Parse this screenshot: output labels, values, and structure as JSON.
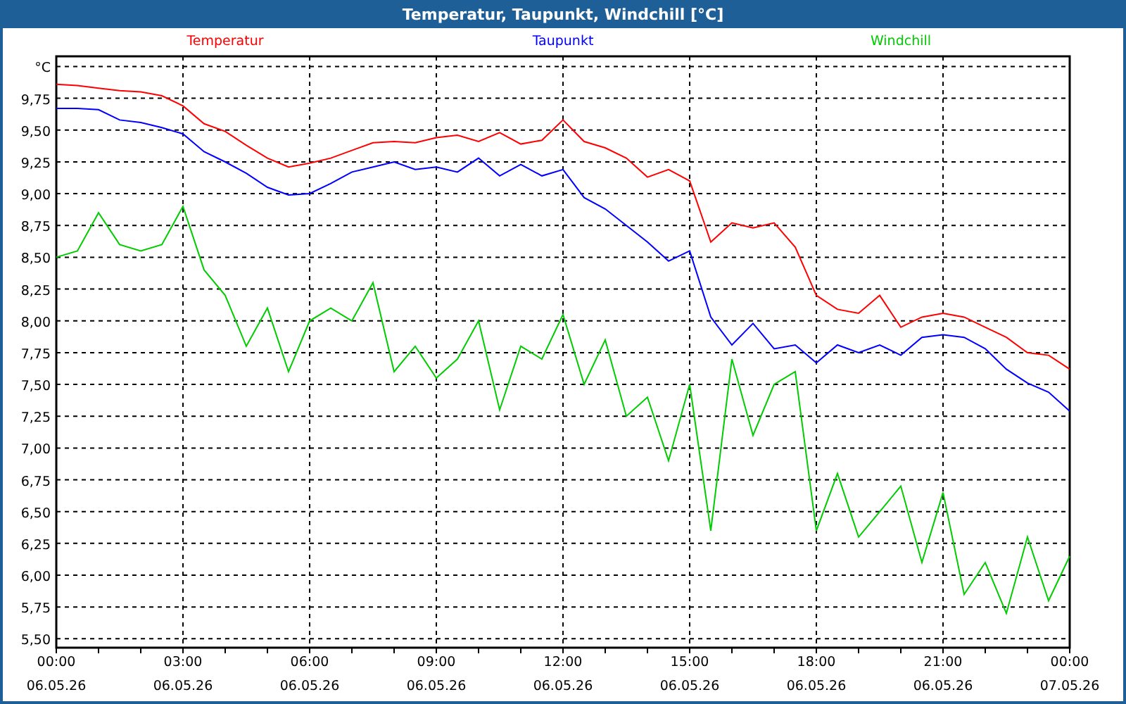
{
  "window": {
    "title": "Temperatur, Taupunkt, Windchill [°C]"
  },
  "chart": {
    "chart_data": {
      "type": "line",
      "ylabel": "°C",
      "x": [
        0,
        0.5,
        1,
        1.5,
        2,
        2.5,
        3,
        3.5,
        4,
        4.5,
        5,
        5.5,
        6,
        6.5,
        7,
        7.5,
        8,
        8.5,
        9,
        9.5,
        10,
        10.5,
        11,
        11.5,
        12,
        12.5,
        13,
        13.5,
        14,
        14.5,
        15,
        15.5,
        16,
        16.5,
        17,
        17.5,
        18,
        18.5,
        19,
        19.5,
        20,
        20.5,
        21,
        21.5,
        22,
        22.5,
        23,
        23.5,
        24
      ],
      "series": [
        {
          "name": "Temperatur",
          "color": "#ff0000",
          "values": [
            9.86,
            9.85,
            9.83,
            9.81,
            9.8,
            9.77,
            9.69,
            9.55,
            9.49,
            9.38,
            9.28,
            9.21,
            9.24,
            9.28,
            9.34,
            9.4,
            9.41,
            9.4,
            9.44,
            9.46,
            9.41,
            9.48,
            9.39,
            9.42,
            9.58,
            9.41,
            9.36,
            9.28,
            9.13,
            9.19,
            9.1,
            8.62,
            8.77,
            8.73,
            8.77,
            8.58,
            8.2,
            8.09,
            8.06,
            8.2,
            7.95,
            8.03,
            8.06,
            8.03,
            7.95,
            7.87,
            7.75,
            7.73,
            7.62
          ]
        },
        {
          "name": "Taupunkt",
          "color": "#0000ff",
          "values": [
            9.67,
            9.67,
            9.66,
            9.58,
            9.56,
            9.52,
            9.47,
            9.33,
            9.25,
            9.16,
            9.05,
            8.99,
            9.0,
            9.08,
            9.17,
            9.21,
            9.25,
            9.19,
            9.21,
            9.17,
            9.28,
            9.14,
            9.23,
            9.14,
            9.19,
            8.97,
            8.88,
            8.75,
            8.62,
            8.47,
            8.55,
            8.03,
            7.81,
            7.98,
            7.78,
            7.81,
            7.67,
            7.81,
            7.75,
            7.81,
            7.73,
            7.87,
            7.89,
            7.87,
            7.78,
            7.62,
            7.51,
            7.44,
            7.29
          ]
        },
        {
          "name": "Windchill",
          "color": "#00cc00",
          "values": [
            8.5,
            8.55,
            8.85,
            8.6,
            8.55,
            8.6,
            8.9,
            8.4,
            8.2,
            7.8,
            8.1,
            7.6,
            8.0,
            8.1,
            8.0,
            8.3,
            7.6,
            7.8,
            7.55,
            7.7,
            8.0,
            7.3,
            7.8,
            7.7,
            8.05,
            7.5,
            7.85,
            7.25,
            7.4,
            6.9,
            7.5,
            6.35,
            7.7,
            7.1,
            7.5,
            7.6,
            6.35,
            6.8,
            6.3,
            6.5,
            6.7,
            6.1,
            6.65,
            5.85,
            6.1,
            5.7,
            6.3,
            5.8,
            6.15
          ]
        }
      ],
      "xlim": [
        0,
        24
      ],
      "ylim": [
        5.43,
        10.08
      ],
      "grid": true,
      "xticks": [
        {
          "value": 0,
          "label": "00:00"
        },
        {
          "value": 3,
          "label": "03:00"
        },
        {
          "value": 6,
          "label": "06:00"
        },
        {
          "value": 9,
          "label": "09:00"
        },
        {
          "value": 12,
          "label": "12:00"
        },
        {
          "value": 15,
          "label": "15:00"
        },
        {
          "value": 18,
          "label": "18:00"
        },
        {
          "value": 21,
          "label": "21:00"
        },
        {
          "value": 24,
          "label": "00:00"
        }
      ],
      "yticks": [
        {
          "value": 5.5,
          "label": "5,50"
        },
        {
          "value": 5.75,
          "label": "5,75"
        },
        {
          "value": 6,
          "label": "6,00"
        },
        {
          "value": 6.25,
          "label": "6,25"
        },
        {
          "value": 6.5,
          "label": "6,50"
        },
        {
          "value": 6.75,
          "label": "6,75"
        },
        {
          "value": 7,
          "label": "7,00"
        },
        {
          "value": 7.25,
          "label": "7,25"
        },
        {
          "value": 7.5,
          "label": "7,50"
        },
        {
          "value": 7.75,
          "label": "7,75"
        },
        {
          "value": 8,
          "label": "8,00"
        },
        {
          "value": 8.25,
          "label": "8,25"
        },
        {
          "value": 8.5,
          "label": "8,50"
        },
        {
          "value": 8.75,
          "label": "8,75"
        },
        {
          "value": 9,
          "label": "9,00"
        },
        {
          "value": 9.25,
          "label": "9,25"
        },
        {
          "value": 9.5,
          "label": "9,50"
        },
        {
          "value": 9.75,
          "label": "9,75"
        }
      ]
    },
    "x_dates": [
      "06.05.26",
      "06.05.26",
      "06.05.26",
      "06.05.26",
      "06.05.26",
      "06.05.26",
      "06.05.26",
      "06.05.26",
      "07.05.26"
    ]
  }
}
